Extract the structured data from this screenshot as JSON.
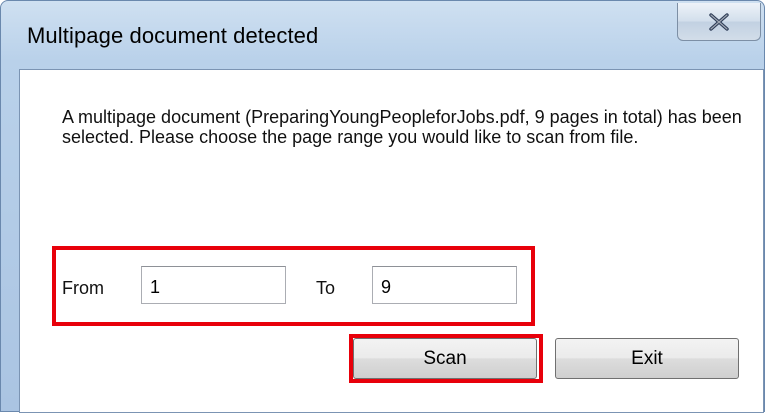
{
  "dialog": {
    "title": "Multipage document detected",
    "close_symbol": "✕",
    "message": "A multipage document (PreparingYoungPeopleforJobs.pdf, 9 pages in total) has been selected. Please choose the page range you would like to scan from file.",
    "range": {
      "from_label": "From",
      "from_value": "1",
      "to_label": "To",
      "to_value": "9"
    },
    "buttons": {
      "scan_label": "Scan",
      "exit_label": "Exit"
    }
  },
  "colors": {
    "highlight": "#e8000a",
    "title_bar": "#b9d1ea",
    "close_glyph": "#2b3a55"
  },
  "icons": {
    "close": "close-icon"
  }
}
